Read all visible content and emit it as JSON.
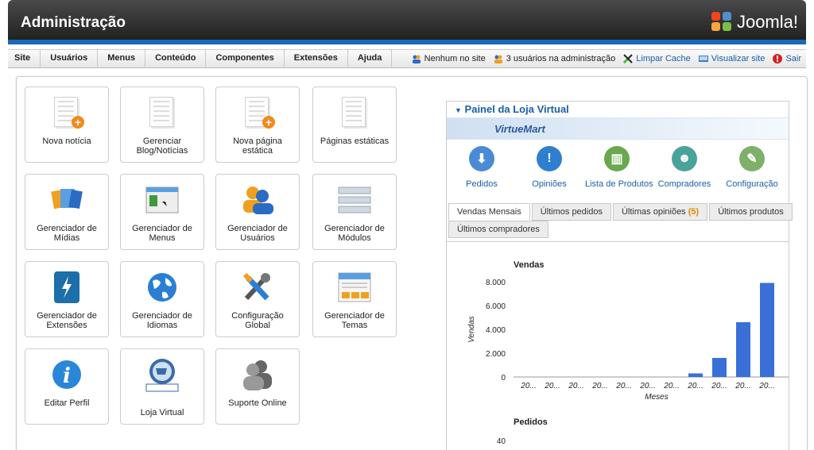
{
  "header": {
    "title": "Administração",
    "brand": "Joomla!"
  },
  "menu": [
    "Site",
    "Usuários",
    "Menus",
    "Conteúdo",
    "Componentes",
    "Extensões",
    "Ajuda"
  ],
  "status": {
    "site_users": "Nenhum no site",
    "admin_users": "3 usuários na administração",
    "clear_cache": "Limpar Cache",
    "view_site": "Visualizar site",
    "logout": "Sair"
  },
  "quickicons": [
    {
      "label": "Nova notícia",
      "icon": "new-article-icon"
    },
    {
      "label": "Gerenciar Blog/Notícias",
      "icon": "article-manager-icon"
    },
    {
      "label": "Nova página estática",
      "icon": "new-static-page-icon"
    },
    {
      "label": "Páginas estáticas",
      "icon": "static-pages-icon"
    },
    {
      "label": "Gerenciador de Mídias",
      "icon": "media-manager-icon"
    },
    {
      "label": "Gerenciador de Menus",
      "icon": "menu-manager-icon"
    },
    {
      "label": "Gerenciador de Usuários",
      "icon": "user-manager-icon"
    },
    {
      "label": "Gerenciador de Módulos",
      "icon": "module-manager-icon"
    },
    {
      "label": "Gerenciador de Extensões",
      "icon": "extension-manager-icon"
    },
    {
      "label": "Gerenciador de Idiomas",
      "icon": "language-manager-icon"
    },
    {
      "label": "Configuração Global",
      "icon": "global-config-icon"
    },
    {
      "label": "Gerenciador de Temas",
      "icon": "template-manager-icon"
    },
    {
      "label": "Editar Perfil",
      "icon": "edit-profile-icon"
    },
    {
      "label": "Loja Virtual",
      "icon": "virtuemart-icon"
    },
    {
      "label": "Suporte Online",
      "icon": "online-support-icon"
    }
  ],
  "vm": {
    "title": "Painel da Loja Virtual",
    "banner": "VirtueMart",
    "icons": [
      {
        "label": "Pedidos",
        "icon": "orders-icon",
        "color": "#4a8bd6"
      },
      {
        "label": "Opiniões",
        "icon": "reviews-icon",
        "color": "#2f7fd0"
      },
      {
        "label": "Lista de Produtos",
        "icon": "product-list-icon",
        "color": "#6aa84f"
      },
      {
        "label": "Compradores",
        "icon": "shoppers-icon",
        "color": "#4aa39a"
      },
      {
        "label": "Configuração",
        "icon": "configuration-icon",
        "color": "#7fb069"
      }
    ],
    "tabs_row1": [
      {
        "label": "Vendas Mensais",
        "count": ""
      },
      {
        "label": "Últimos pedidos",
        "count": ""
      },
      {
        "label": "Últimas opiniões",
        "count": "(5)"
      },
      {
        "label": "Últimos produtos",
        "count": ""
      }
    ],
    "tabs_row2": [
      {
        "label": "Últimos compradores",
        "count": ""
      }
    ]
  },
  "chart_data": [
    {
      "type": "bar",
      "title": "Vendas",
      "xlabel": "Meses",
      "ylabel": "Vendas",
      "ylim": [
        0,
        8000
      ],
      "yticks": [
        "8.000",
        "6.000",
        "4.000",
        "2.000",
        "0"
      ],
      "categories": [
        "20...",
        "20...",
        "20...",
        "20...",
        "20...",
        "20...",
        "20...",
        "20...",
        "20...",
        "20...",
        "20..."
      ],
      "values": [
        0,
        0,
        0,
        0,
        0,
        0,
        0,
        300,
        1600,
        4600,
        7900
      ],
      "color": "#3a6fd8"
    },
    {
      "type": "bar",
      "title": "Pedidos",
      "yticks": [
        "40"
      ],
      "values": []
    }
  ]
}
